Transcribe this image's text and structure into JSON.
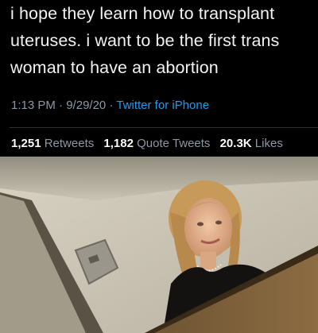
{
  "tweet": {
    "lines": [
      "i hope they learn how to transplant",
      "uteruses. i want to be the first trans",
      "woman to have an abortion"
    ],
    "time": "1:13 PM",
    "date": "9/29/20",
    "source": "Twitter for iPhone",
    "retweets_count": "1,251",
    "retweets_label": "Retweets",
    "quote_count": "1,182",
    "quote_label": "Quote Tweets",
    "likes_count": "20.3K",
    "likes_label": "Likes"
  },
  "colors": {
    "background": "#000000",
    "text": "#f2f2f2",
    "muted": "#8b98a5",
    "link": "#1d9bf0"
  }
}
